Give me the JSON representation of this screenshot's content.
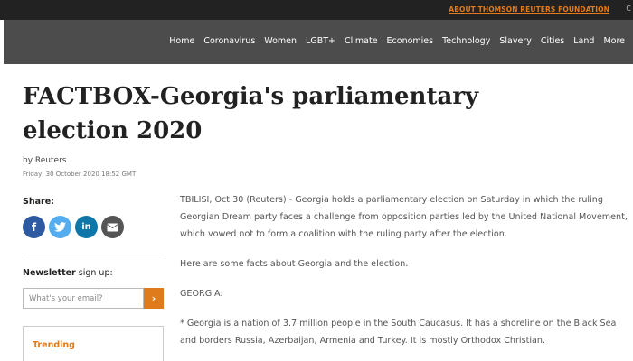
{
  "topbar": {
    "about_link": "ABOUT THOMSON REUTERS FOUNDATION",
    "edge_glyph": "C"
  },
  "nav": {
    "items": [
      "Home",
      "Coronavirus",
      "Women",
      "LGBT+",
      "Climate",
      "Economies",
      "Technology",
      "Slavery",
      "Cities",
      "Land",
      "More"
    ]
  },
  "article": {
    "title": "FACTBOX-Georgia's parliamentary election 2020",
    "byline_prefix": "by",
    "author": "Reuters",
    "date": "Friday, 30 October 2020 18:52 GMT",
    "paragraphs": [
      "TBILISI, Oct 30 (Reuters) - Georgia holds a parliamentary election on Saturday in which the ruling Georgian Dream party faces a challenge from opposition parties led by the United National Movement, which vowed not to form a coalition with the ruling party after the election.",
      "Here are some facts about Georgia and the election.",
      "GEORGIA:",
      "* Georgia is a nation of 3.7 million people in the South Caucasus. It has a shoreline on the Black Sea and borders Russia, Azerbaijan, Armenia and Turkey. It is mostly Orthodox Christian."
    ]
  },
  "sidebar": {
    "share_label": "Share:",
    "share_buttons": [
      {
        "name": "facebook",
        "glyph": "f",
        "color": "#2d5aa0"
      },
      {
        "name": "twitter",
        "glyph": "t",
        "color": "#55acee"
      },
      {
        "name": "linkedin",
        "glyph": "in",
        "color": "#0e76a8"
      },
      {
        "name": "email",
        "glyph": "✉",
        "color": "#555555"
      }
    ],
    "newsletter_bold": "Newsletter",
    "newsletter_rest": " sign up:",
    "email_placeholder": "What's your email?",
    "submit_glyph": "›",
    "trending_label": "Trending"
  },
  "colors": {
    "accent": "#e07b1c",
    "nav_bg": "#4c4c4c",
    "topbar_bg": "#222222"
  }
}
